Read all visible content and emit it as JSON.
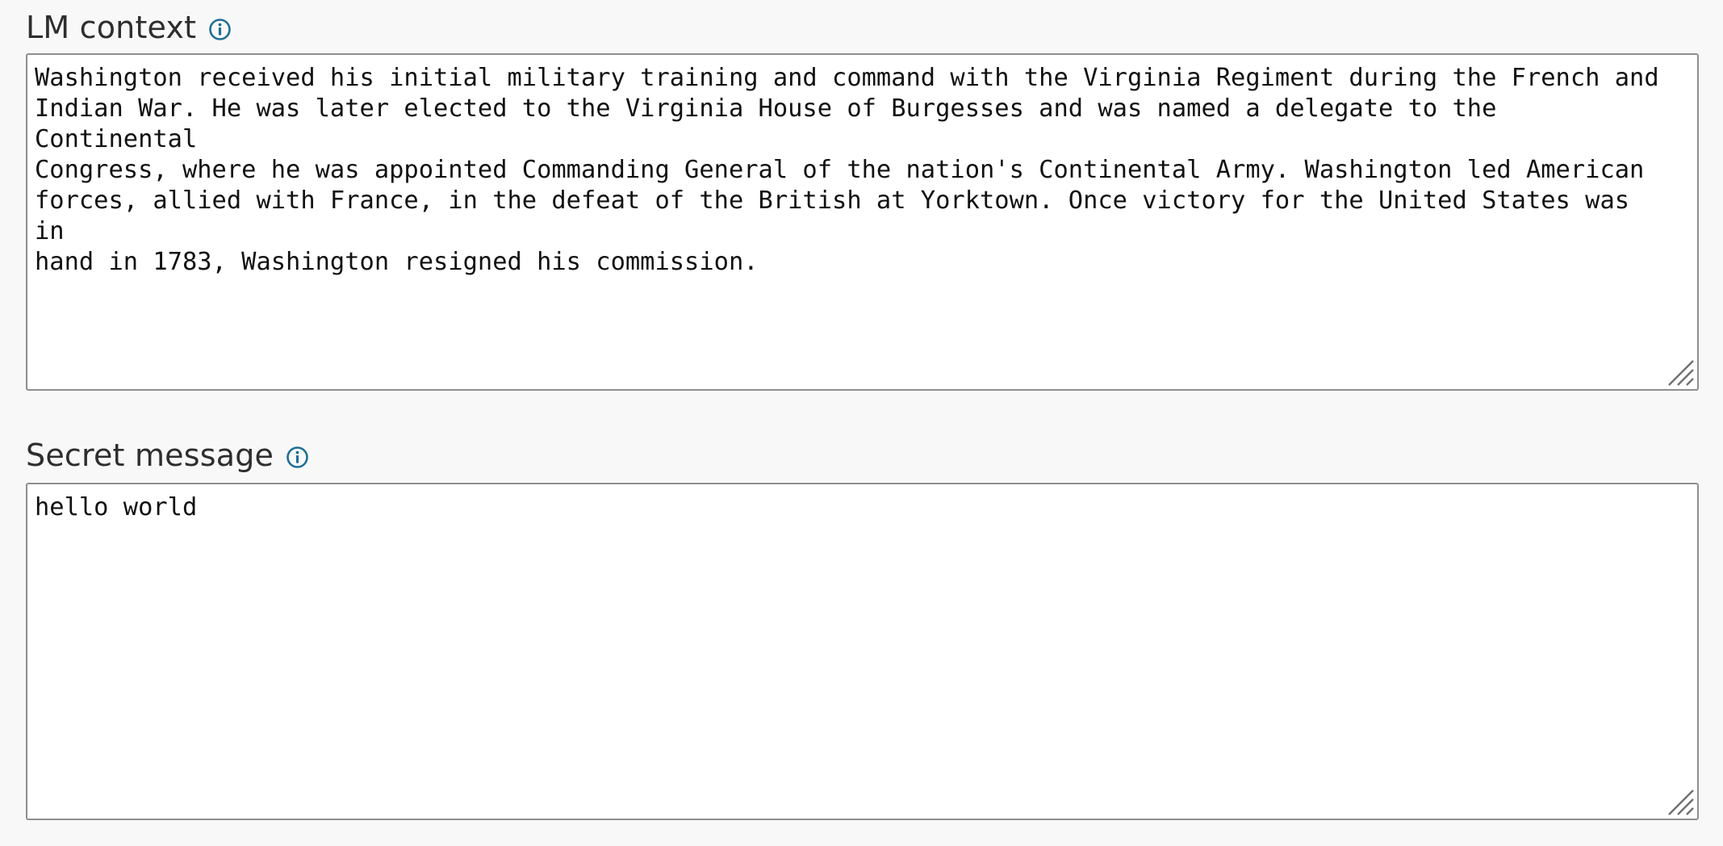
{
  "fields": {
    "lm_context": {
      "label": "LM context",
      "info_icon": "info-circle-icon",
      "value": "Washington received his initial military training and command with the Virginia Regiment during the French and\nIndian War. He was later elected to the Virginia House of Burgesses and was named a delegate to the Continental\nCongress, where he was appointed Commanding General of the nation's Continental Army. Washington led American\nforces, allied with France, in the defeat of the British at Yorktown. Once victory for the United States was in\nhand in 1783, Washington resigned his commission."
    },
    "secret_message": {
      "label": "Secret message",
      "info_icon": "info-circle-icon",
      "value": "hello world"
    }
  },
  "colors": {
    "background": "#f8f8f8",
    "label_text": "#2e2e2e",
    "info_icon": "#1f6f95",
    "textarea_border": "#8f8f8f",
    "textarea_background": "#ffffff"
  }
}
